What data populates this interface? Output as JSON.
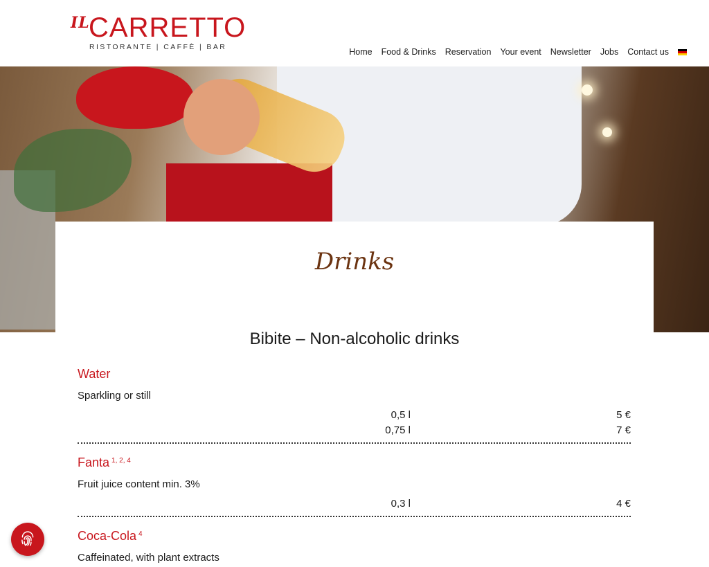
{
  "header": {
    "logo_prefix": "IL",
    "logo_name": "CARRETTO",
    "logo_tagline": "RISTORANTE | CAFFÈ | BAR",
    "nav": [
      {
        "label": "Home"
      },
      {
        "label": "Food & Drinks"
      },
      {
        "label": "Reservation"
      },
      {
        "label": "Your event"
      },
      {
        "label": "Newsletter"
      },
      {
        "label": "Jobs"
      },
      {
        "label": "Contact us"
      }
    ],
    "language_flag": "german-flag-icon"
  },
  "colors": {
    "brand_red": "#c8161d",
    "title_brown": "#6b3310"
  },
  "main": {
    "page_title": "Drinks",
    "section_title": "Bibite – Non-alcoholic drinks",
    "items": [
      {
        "name": "Water",
        "allergens": "",
        "description": "Sparkling or still",
        "prices": [
          {
            "size": "0,5 l",
            "price": "5 €"
          },
          {
            "size": "0,75 l",
            "price": "7 €"
          }
        ]
      },
      {
        "name": "Fanta",
        "allergens": "1, 2, 4",
        "description": "Fruit juice content min. 3%",
        "prices": [
          {
            "size": "0,3 l",
            "price": "4 €"
          }
        ]
      },
      {
        "name": "Coca-Cola",
        "allergens": "4",
        "description": "Caffeinated, with plant extracts",
        "prices": []
      }
    ]
  },
  "cookie_button": {
    "icon": "fingerprint-icon"
  }
}
